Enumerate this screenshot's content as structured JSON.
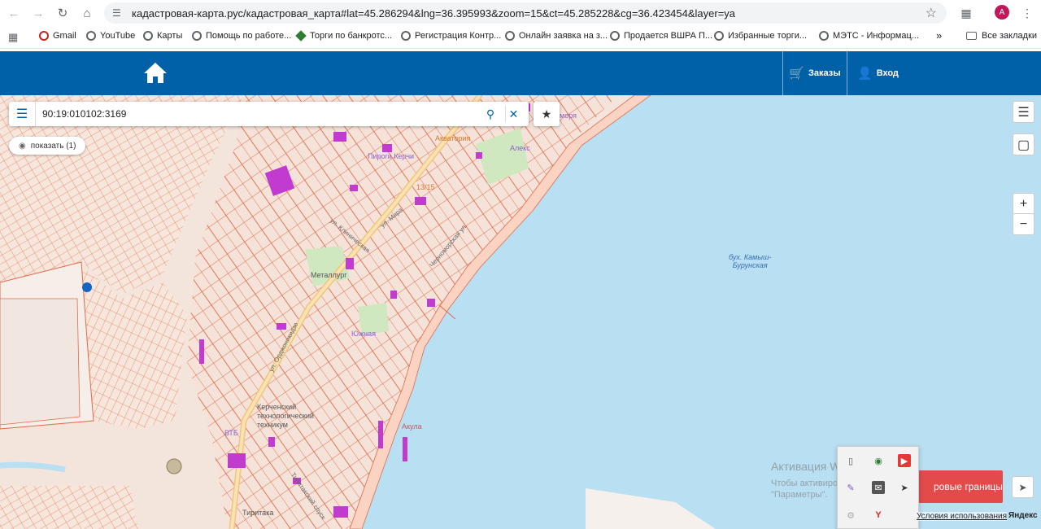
{
  "browser": {
    "url": "кадастровая-карта.рус/кадастровая_карта#lat=45.286294&lng=36.395993&zoom=15&ct=45.285228&cg=36.423454&layer=ya",
    "avatar_letter": "A",
    "bookmarks": [
      "Gmail",
      "YouTube",
      "Карты",
      "Помощь по работе...",
      "Торги по банкротс...",
      "Регистрация Контр...",
      "Онлайн заявка на з...",
      "Продается ВШРА П...",
      "Избранные торги...",
      "МЭТС - Информац..."
    ],
    "all_bookmarks": "Все закладки",
    "more": "»"
  },
  "header": {
    "orders_label": "Заказы",
    "login_label": "Вход",
    "color": "#0061a8"
  },
  "search": {
    "value": "90:19:010102:3169",
    "show_label": "показать (1)"
  },
  "map": {
    "bay_label_1": "бух. Камыш-",
    "bay_label_2": "Бурунская",
    "poi": {
      "akvatoria": "Акватория",
      "more": "моря",
      "aleks": "Алекс",
      "pirogi": "Пироги Керчи",
      "num": "13/15",
      "metallurg": "Металлург",
      "yuzhnaya": "Южная",
      "tech1": "Керченский",
      "tech2": "технологический",
      "tech3": "техникум",
      "vtb": "ВТБ",
      "tiritaka": "Тиритака",
      "akula": "Акула"
    },
    "streets": {
      "mira": "ул. Мира",
      "ordzh": "ул. Орджоникидзе",
      "chernomorskaya": "Черноморская ул.",
      "tiritakskiy": "Тиритакский спуск",
      "klinicheskaya": "ул. Клиническая"
    },
    "cadastral_button": "ровые границы",
    "terms": "Условия использования",
    "yandex": "Яндекс",
    "colors": {
      "water": "#b9dff3",
      "land": "#f3e8e2",
      "parcel": "#e06a4a",
      "building": "#c13bd1"
    }
  },
  "windows_activation": {
    "title": "Активация Windows",
    "text": "Чтобы активировать Windows, перейдите в раздел \"Параметры\"."
  }
}
